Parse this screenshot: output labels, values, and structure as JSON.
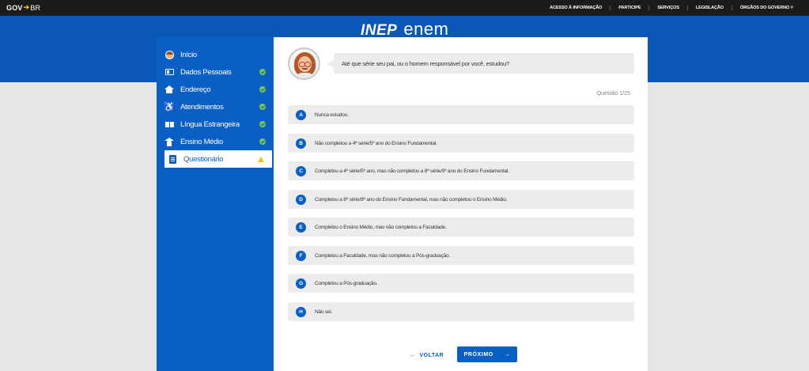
{
  "govbar": {
    "logo_gov": "GOV",
    "logo_br": "BR",
    "links": [
      "ACESSO À INFORMAÇÃO",
      "PARTICIPE",
      "SERVIÇOS",
      "LEGISLAÇÃO",
      "ÓRGÃOS DO GOVERNO"
    ]
  },
  "brand": {
    "inep": "INEP",
    "enem": "enem"
  },
  "sidebar": {
    "items": [
      {
        "label": "Início",
        "icon": "avatar-icon",
        "status": "none"
      },
      {
        "label": "Dados Pessoais",
        "icon": "id-card-icon",
        "status": "complete"
      },
      {
        "label": "Endereço",
        "icon": "house-icon",
        "status": "complete"
      },
      {
        "label": "Atendimentos",
        "icon": "accessibility-icon",
        "status": "complete"
      },
      {
        "label": "Língua Estrangeira",
        "icon": "language-icon",
        "status": "complete"
      },
      {
        "label": "Ensino Médio",
        "icon": "graduation-icon",
        "status": "complete"
      },
      {
        "label": "Questionário",
        "icon": "clipboard-icon",
        "status": "warning",
        "active": true
      }
    ]
  },
  "question": {
    "text": "Até que série seu pai, ou o homem responsável por você, estudou?",
    "counter": "Questão 1/25"
  },
  "options": [
    {
      "letter": "A",
      "text": "Nunca estudou."
    },
    {
      "letter": "B",
      "text": "Não completou a 4ª série/5º ano do Ensino Fundamental."
    },
    {
      "letter": "C",
      "text": "Completou a 4ª série/5º ano, mas não completou a 8ª série/9º ano do Ensino Fundamental."
    },
    {
      "letter": "D",
      "text": "Completou a 8ª série/9º ano do Ensino Fundamental, mas não completou o Ensino Médio."
    },
    {
      "letter": "E",
      "text": "Completou o Ensino Médio, mas não completou a Faculdade."
    },
    {
      "letter": "F",
      "text": "Completou a Faculdade, mas não completou a Pós-graduação."
    },
    {
      "letter": "G",
      "text": "Completou a Pós-graduação."
    },
    {
      "letter": "H",
      "text": "Não sei."
    }
  ],
  "nav": {
    "back_label": "VOLTAR",
    "next_label": "PRÓXIMO"
  },
  "colors": {
    "primary": "#0a5fc4",
    "band": "#0a57b8",
    "check": "#7cc84a",
    "warning": "#f3c313"
  }
}
